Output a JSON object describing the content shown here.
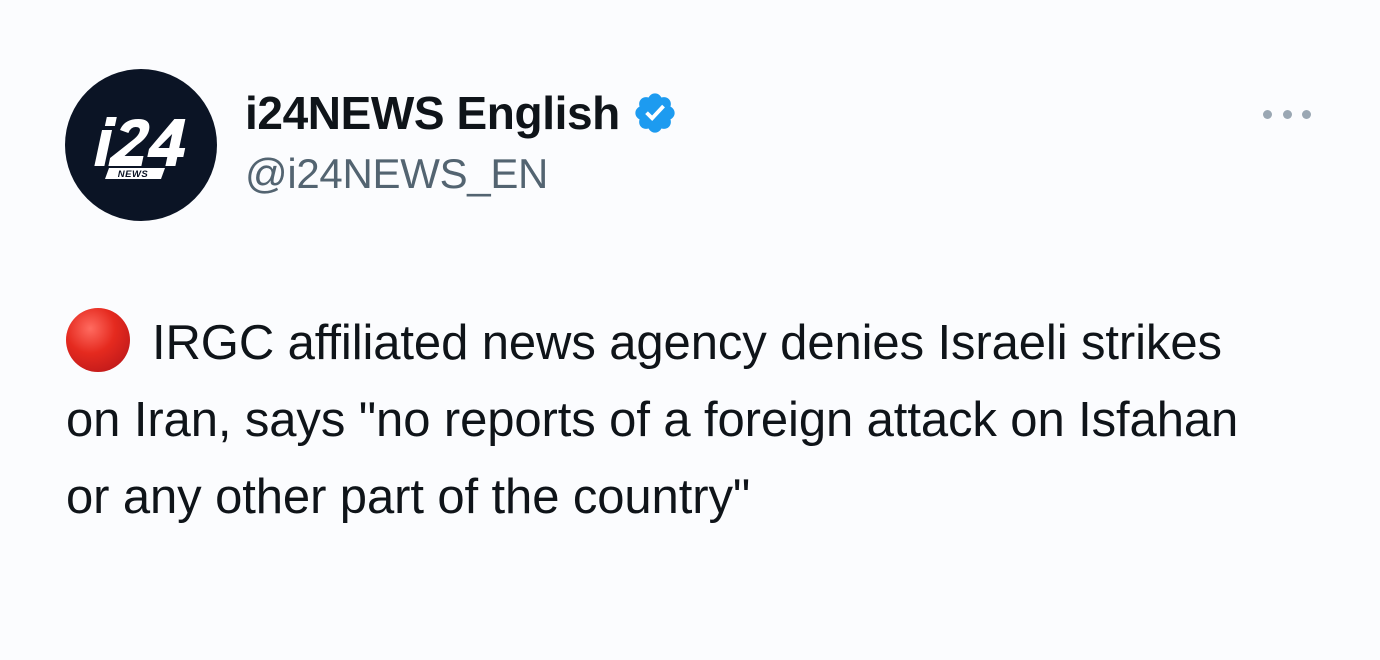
{
  "account": {
    "display_name": "i24NEWS English",
    "handle": "@i24NEWS_EN",
    "verified": true,
    "avatar_logo_text": "i24",
    "avatar_logo_subtext": "NEWS"
  },
  "tweet": {
    "text": "IRGC affiliated news agency denies Israeli strikes on Iran, says \"no reports of a foreign attack on Isfahan or any other part of the country\"",
    "leading_emoji": "red-circle-icon"
  },
  "icons": {
    "verified": "verified-badge-icon",
    "more": "more-options-icon"
  },
  "colors": {
    "background": "#fbfcfe",
    "text_primary": "#0f1419",
    "text_secondary": "#536471",
    "verified_blue": "#1d9bf0",
    "avatar_bg": "#0b1425",
    "red_emoji": "#e52a1f"
  }
}
